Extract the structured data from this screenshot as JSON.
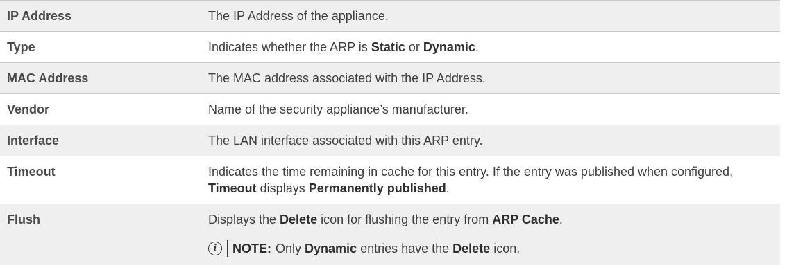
{
  "rows": [
    {
      "term": "IP Address",
      "def": [
        "The IP Address of the appliance."
      ]
    },
    {
      "term": "Type",
      "def": [
        "Indicates whether the ARP is ",
        "Static",
        " or ",
        "Dynamic",
        "."
      ]
    },
    {
      "term": "MAC Address",
      "def": [
        "The MAC address associated with the IP Address."
      ]
    },
    {
      "term": "Vendor",
      "def": [
        "Name of the security appliance’s manufacturer."
      ]
    },
    {
      "term": "Interface",
      "def": [
        "The LAN interface associated with this ARP entry."
      ]
    },
    {
      "term": "Timeout",
      "def": [
        "Indicates the time remaining in cache for this entry. If the entry was published when configured, ",
        "Timeout",
        " displays ",
        "Permanently published",
        "."
      ]
    },
    {
      "term": "Flush",
      "def": [
        "Displays the ",
        "Delete",
        " icon for flushing the entry from ",
        "ARP Cache",
        "."
      ]
    }
  ],
  "note": {
    "icon": "info-icon",
    "icon_glyph": "i",
    "label": "NOTE:",
    "text": [
      "Only ",
      "Dynamic",
      " entries have the ",
      "Delete",
      " icon."
    ]
  }
}
